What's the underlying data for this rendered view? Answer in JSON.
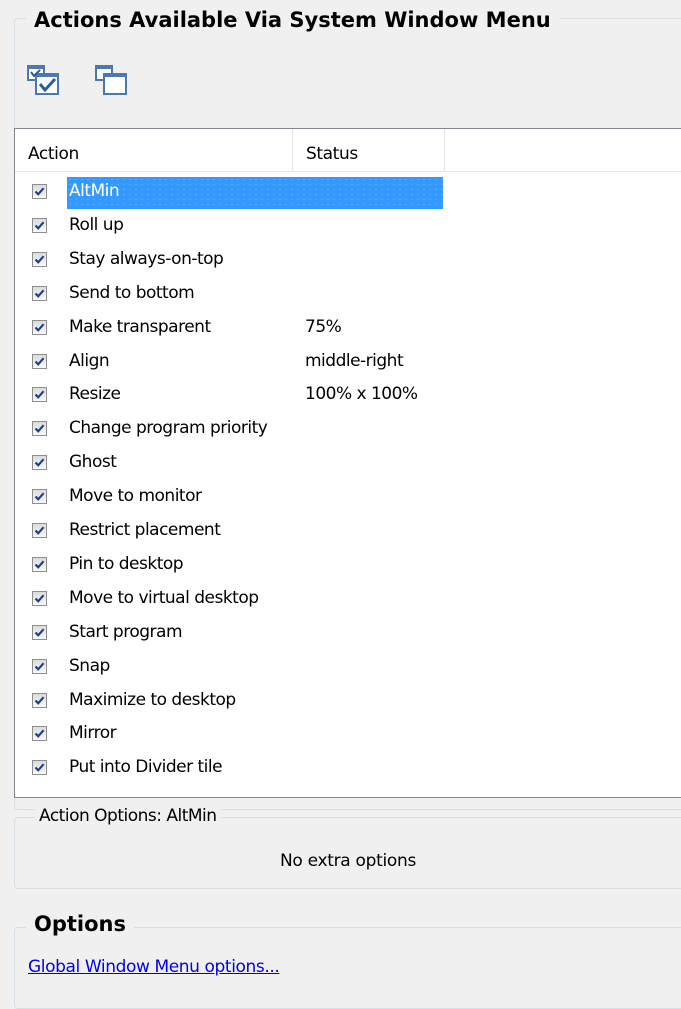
{
  "header": {
    "title": "Actions Available Via System Window Menu"
  },
  "toolbar": {
    "buttons": [
      {
        "icon": "check-all-windows-icon"
      },
      {
        "icon": "uncheck-all-windows-icon"
      }
    ]
  },
  "list": {
    "columns": [
      "Action",
      "Status"
    ],
    "rows": [
      {
        "action": "AltMin",
        "status": "",
        "checked": true,
        "selected": true
      },
      {
        "action": "Roll up",
        "status": "",
        "checked": true
      },
      {
        "action": "Stay always-on-top",
        "status": "",
        "checked": true
      },
      {
        "action": "Send to bottom",
        "status": "",
        "checked": true
      },
      {
        "action": "Make transparent",
        "status": "75%",
        "checked": true
      },
      {
        "action": "Align",
        "status": "middle-right",
        "checked": true
      },
      {
        "action": "Resize",
        "status": "100% x 100%",
        "checked": true
      },
      {
        "action": "Change program priority",
        "status": "",
        "checked": true
      },
      {
        "action": "Ghost",
        "status": "",
        "checked": true
      },
      {
        "action": "Move to monitor",
        "status": "",
        "checked": true
      },
      {
        "action": "Restrict placement",
        "status": "",
        "checked": true
      },
      {
        "action": "Pin to desktop",
        "status": "",
        "checked": true
      },
      {
        "action": "Move to virtual desktop",
        "status": "",
        "checked": true
      },
      {
        "action": "Start program",
        "status": "",
        "checked": true
      },
      {
        "action": "Snap",
        "status": "",
        "checked": true
      },
      {
        "action": "Maximize to desktop",
        "status": "",
        "checked": true
      },
      {
        "action": "Mirror",
        "status": "",
        "checked": true
      },
      {
        "action": "Put into Divider tile",
        "status": "",
        "checked": true
      }
    ]
  },
  "action_options": {
    "legend": "Action Options: AltMin",
    "text": "No extra options"
  },
  "options": {
    "title": "Options",
    "link": "Global Window Menu options..."
  },
  "colors": {
    "selection": "#3399ff",
    "link": "#0000ee",
    "background": "#f0f0f0"
  }
}
